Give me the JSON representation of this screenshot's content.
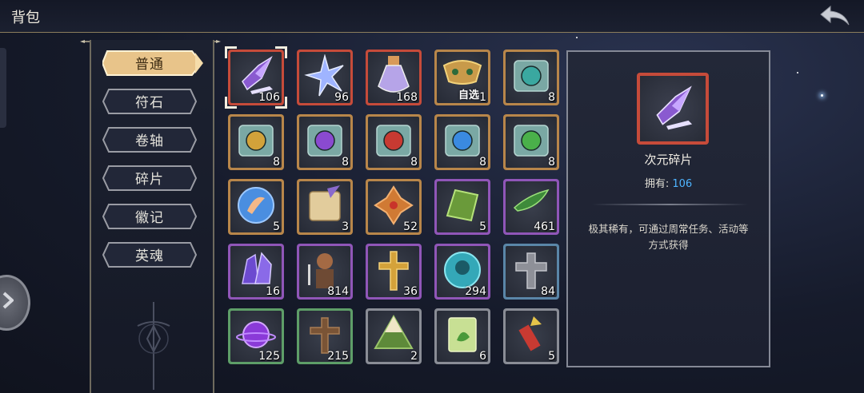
{
  "header": {
    "title": "背包"
  },
  "sidebar": {
    "tabs": [
      {
        "label": "普通",
        "active": true
      },
      {
        "label": "符石",
        "active": false
      },
      {
        "label": "卷轴",
        "active": false
      },
      {
        "label": "碎片",
        "active": false
      },
      {
        "label": "徽记",
        "active": false
      },
      {
        "label": "英魂",
        "active": false
      }
    ]
  },
  "items": [
    {
      "icon": "purple-crystal-shard-icon",
      "count": "106",
      "frame": "#c64b3a",
      "selected": true
    },
    {
      "icon": "star-crystal-icon",
      "count": "96",
      "frame": "#c64b3a"
    },
    {
      "icon": "potion-bottle-icon",
      "count": "168",
      "frame": "#c64b3a"
    },
    {
      "icon": "mask-selectable-icon",
      "count": "1",
      "frame": "#b8864a",
      "tag": "自选"
    },
    {
      "icon": "teal-rune-scroll-icon",
      "count": "8",
      "frame": "#b8864a"
    },
    {
      "icon": "yellow-rune-scroll-icon",
      "count": "8",
      "frame": "#b8864a"
    },
    {
      "icon": "purple-rune-scroll-icon",
      "count": "8",
      "frame": "#b8864a"
    },
    {
      "icon": "red-rune-scroll-icon",
      "count": "8",
      "frame": "#b8864a"
    },
    {
      "icon": "blue-rune-scroll-icon",
      "count": "8",
      "frame": "#b8864a"
    },
    {
      "icon": "green-rune-scroll-icon",
      "count": "8",
      "frame": "#b8864a"
    },
    {
      "icon": "blue-feather-badge-icon",
      "count": "5",
      "frame": "#b8864a"
    },
    {
      "icon": "parchment-quill-icon",
      "count": "3",
      "frame": "#b8864a"
    },
    {
      "icon": "orange-cross-ornament-icon",
      "count": "52",
      "frame": "#b8864a"
    },
    {
      "icon": "green-crystal-tablet-icon",
      "count": "5",
      "frame": "#9056b8"
    },
    {
      "icon": "green-leaf-blade-icon",
      "count": "461",
      "frame": "#9056b8"
    },
    {
      "icon": "violet-crystal-cluster-icon",
      "count": "16",
      "frame": "#9056b8"
    },
    {
      "icon": "warrior-figure-icon",
      "count": "814",
      "frame": "#9056b8"
    },
    {
      "icon": "golden-cross-icon",
      "count": "36",
      "frame": "#9056b8"
    },
    {
      "icon": "cyan-skull-token-icon",
      "count": "294",
      "frame": "#9056b8"
    },
    {
      "icon": "gray-stone-cross-icon",
      "count": "84",
      "frame": "#5a86a8"
    },
    {
      "icon": "purple-orb-icon",
      "count": "125",
      "frame": "#5e9e68"
    },
    {
      "icon": "wooden-cross-icon",
      "count": "215",
      "frame": "#5e9e68"
    },
    {
      "icon": "rice-dumpling-icon",
      "count": "2",
      "frame": "#8a8d96"
    },
    {
      "icon": "seed-packet-icon",
      "count": "6",
      "frame": "#8a8d96"
    },
    {
      "icon": "firework-rocket-icon",
      "count": "5",
      "frame": "#8a8d96"
    }
  ],
  "detail": {
    "name": "次元碎片",
    "owned_label": "拥有:",
    "owned_value": "106",
    "description": "极其稀有，可通过周常任务、活动等方式获得"
  }
}
